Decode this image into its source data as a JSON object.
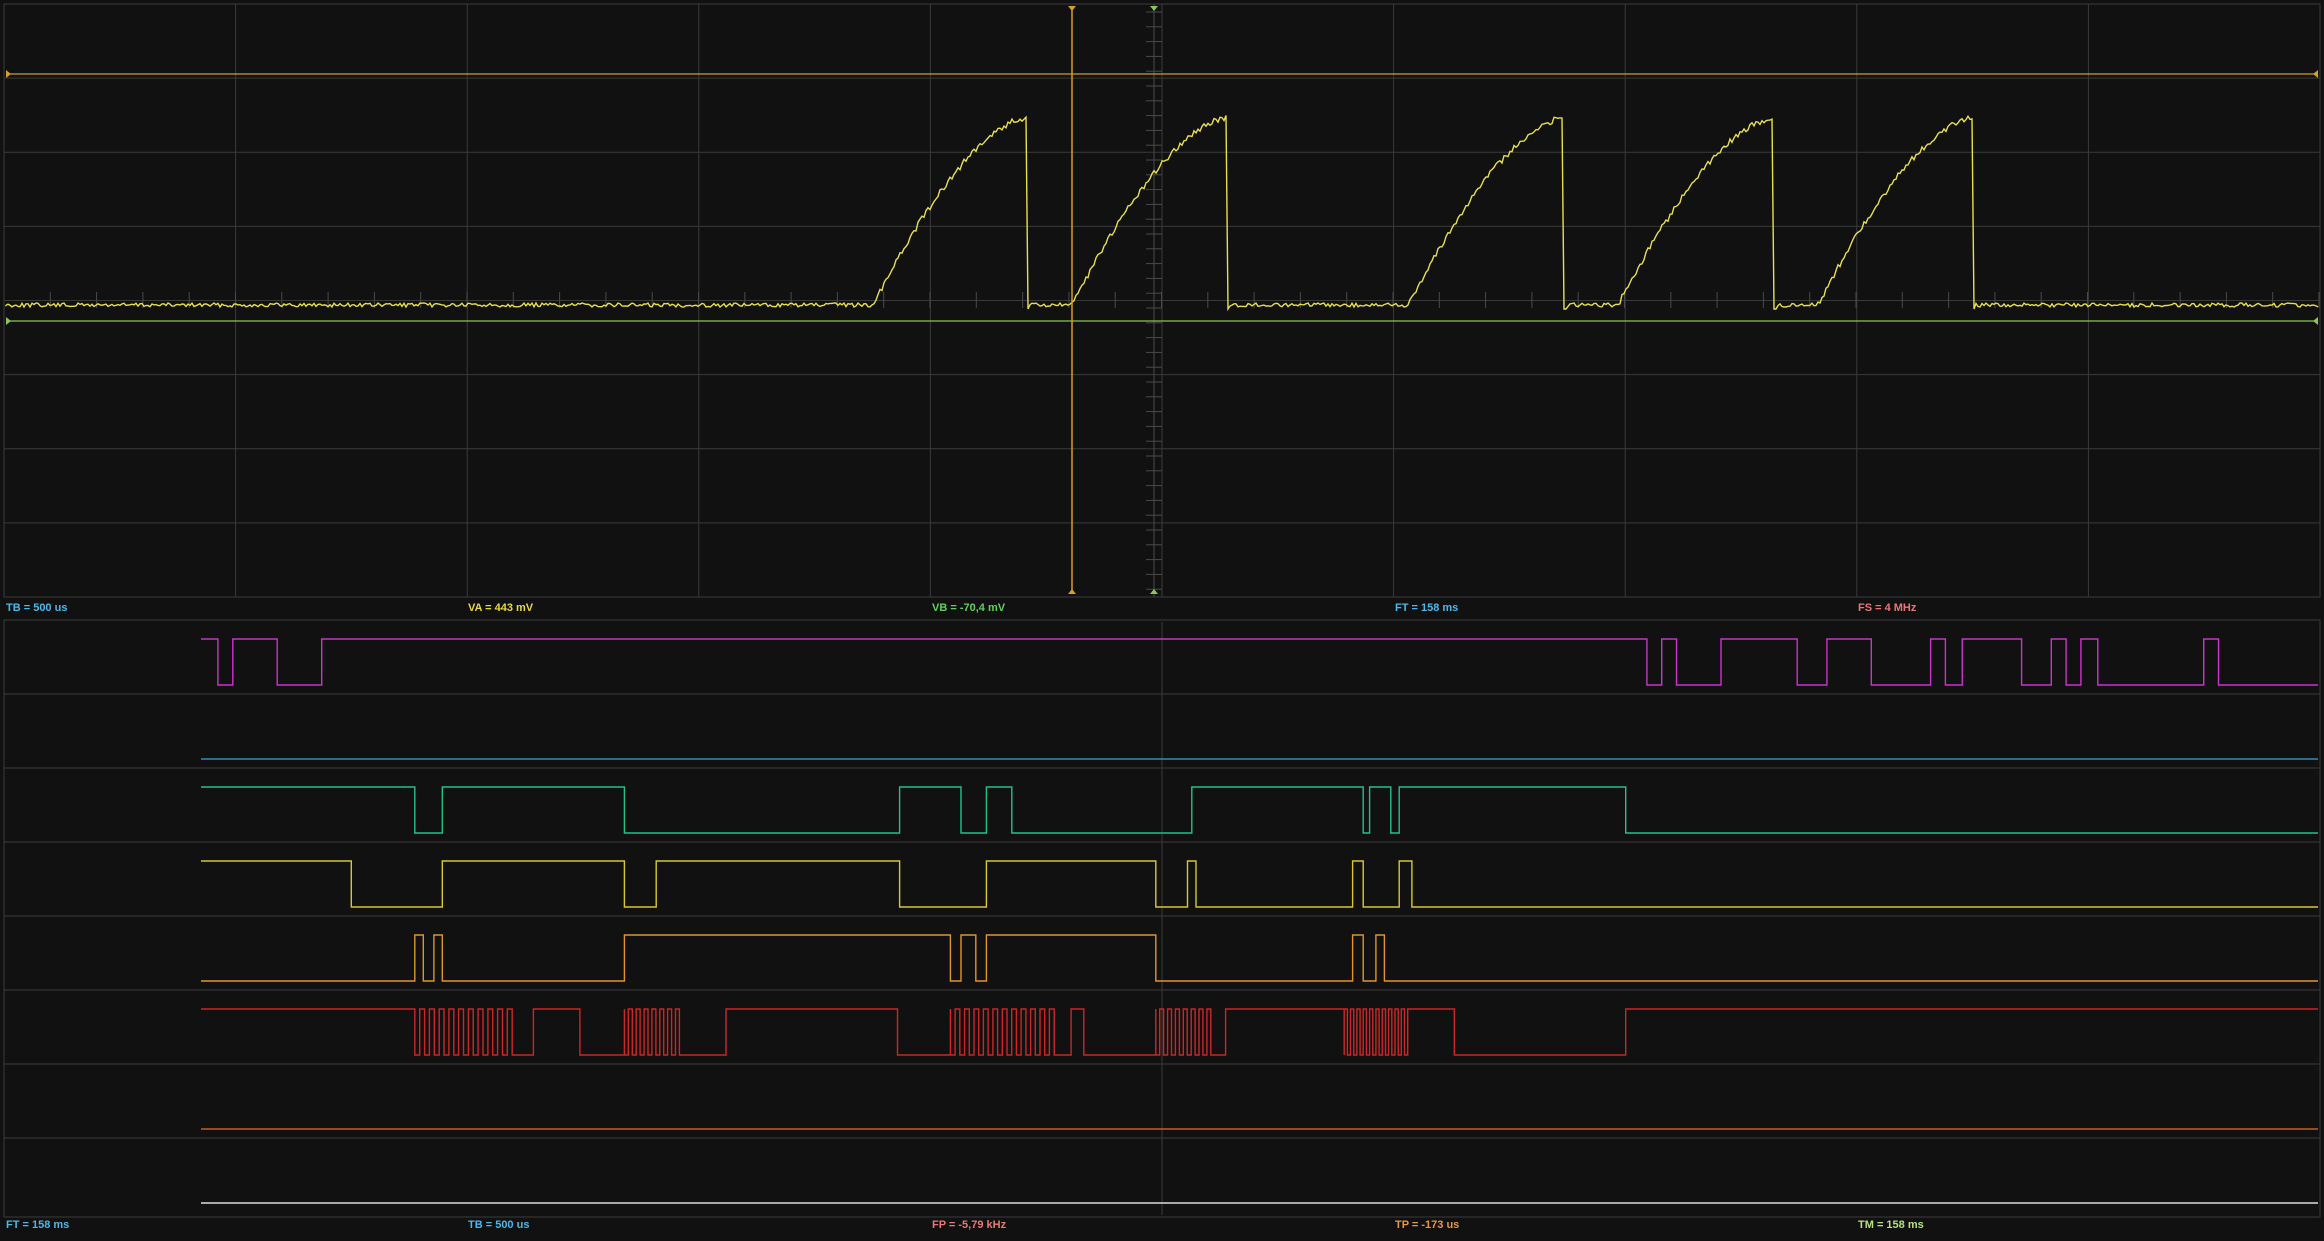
{
  "analog": {
    "status": {
      "tb": "TB = 500 us",
      "va": "VA = 443 mV",
      "vb": "VB = -70,4 mV",
      "ft": "FT = 158 ms",
      "fs": "FS = 4 MHz"
    }
  },
  "digital": {
    "status": {
      "ft": "FT = 158 ms",
      "tb": "TB = 500 us",
      "fp": "FP = -5,79 kHz",
      "tp": "TP = -173 us",
      "tm": "TM = 158 ms"
    },
    "channels": [
      {
        "color": "#cc33cc",
        "initial": 1,
        "toggles_pct": [
          0.8,
          1.5,
          3.6,
          5.7,
          68.3,
          69.0,
          69.7,
          71.8,
          75.4,
          76.8,
          78.9,
          81.7,
          82.4,
          83.2,
          86.0,
          87.4,
          88.1,
          88.8,
          89.6,
          94.6,
          95.3
        ]
      },
      {
        "color": "#2a8fbf",
        "initial": 0,
        "toggles_pct": []
      },
      {
        "color": "#24c08c",
        "initial": 1,
        "toggles_pct": [
          10.1,
          11.4,
          20.0,
          33.0,
          35.9,
          37.1,
          38.3,
          46.8,
          54.9,
          55.2,
          56.2,
          56.6,
          67.3
        ]
      },
      {
        "color": "#d8c82e",
        "initial": 1,
        "toggles_pct": [
          7.1,
          11.4,
          20.0,
          21.5,
          33.0,
          37.1,
          45.1,
          46.6,
          47.0,
          54.4,
          54.9,
          56.6,
          57.2
        ]
      },
      {
        "color": "#e0952a",
        "initial": 0,
        "toggles_pct": [
          10.1,
          10.5,
          11.0,
          11.4,
          20.0,
          35.4,
          35.9,
          36.6,
          37.1,
          45.1,
          54.4,
          54.9,
          55.5,
          55.9
        ]
      },
      {
        "color": "#cc2626",
        "initial": 1,
        "bursts_pct": [
          [
            10.1,
            14.7,
            10
          ],
          [
            20.0,
            22.6,
            7
          ],
          [
            35.4,
            40.3,
            11
          ],
          [
            45.1,
            47.7,
            7
          ],
          [
            54.0,
            57.0,
            10
          ]
        ],
        "toggles_pct": [
          14.7,
          15.7,
          17.9,
          20.0,
          22.6,
          24.8,
          32.9,
          35.4,
          40.3,
          41.1,
          41.7,
          45.1,
          47.7,
          48.4,
          54.0,
          57.0,
          59.2,
          67.3
        ]
      },
      {
        "color": "#c0602a",
        "initial": 0,
        "toggles_pct": []
      },
      {
        "color": "#dddddd",
        "initial": 0,
        "toggles_pct": []
      }
    ]
  },
  "colors": {
    "background": "#111111",
    "grid": "#3a3a3a",
    "analog_trace": "#e8e04a",
    "cursor_a": "#d4a020",
    "cursor_b": "#8bc45a",
    "label_cyan": "#4ab8e8",
    "label_yellow": "#e8d840",
    "label_green": "#60d060",
    "label_pink": "#e87878",
    "label_orange": "#e89838",
    "label_lightgreen": "#b8e080"
  }
}
